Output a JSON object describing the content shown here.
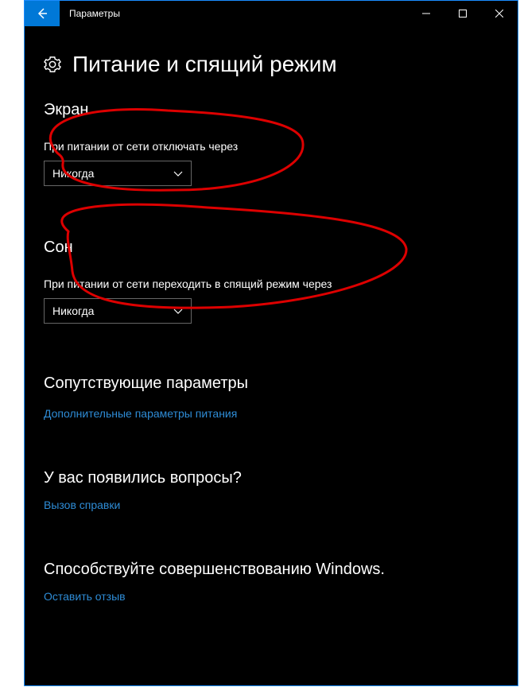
{
  "window": {
    "title": "Параметры"
  },
  "page": {
    "title": "Питание и спящий режим"
  },
  "sections": {
    "screen": {
      "heading": "Экран",
      "label": "При питании от сети отключать через",
      "value": "Никогда"
    },
    "sleep": {
      "heading": "Сон",
      "label": "При питании от сети переходить в спящий режим через",
      "value": "Никогда"
    },
    "related": {
      "heading": "Сопутствующие параметры",
      "link": "Дополнительные параметры питания"
    },
    "help": {
      "heading": "У вас появились вопросы?",
      "link": "Вызов справки"
    },
    "feedback": {
      "heading": "Способствуйте совершенствованию Windows.",
      "link": "Оставить отзыв"
    }
  }
}
